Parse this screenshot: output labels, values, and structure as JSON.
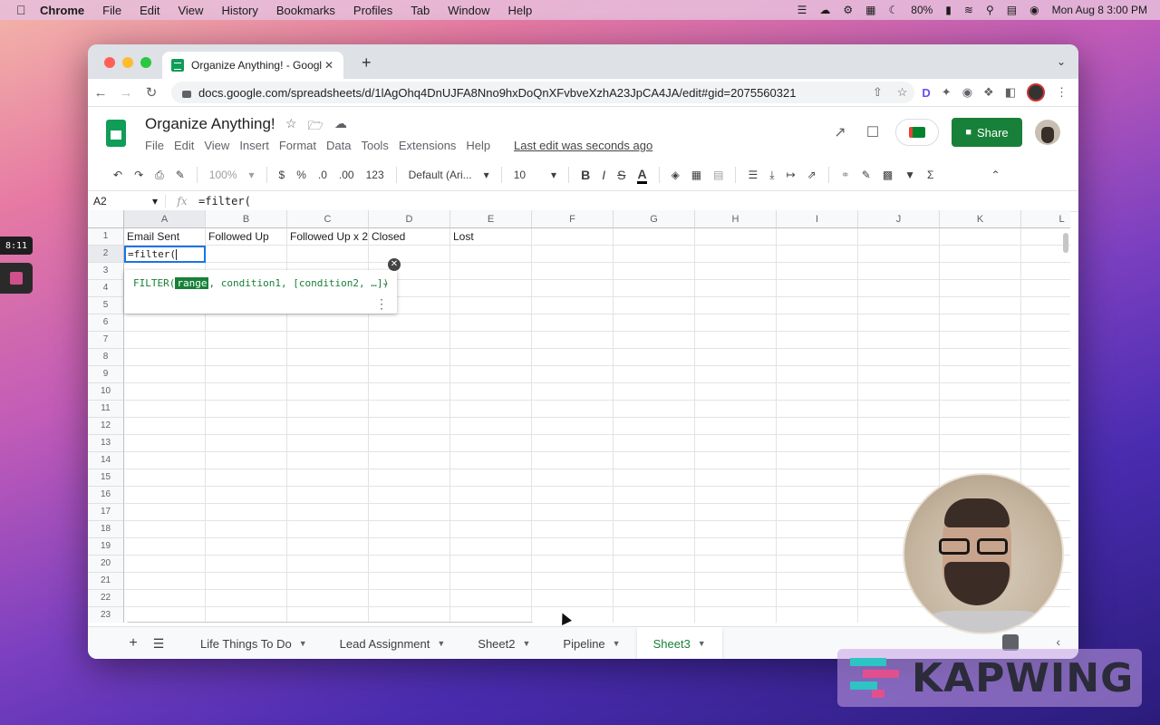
{
  "menubar": {
    "app": "Chrome",
    "items": [
      "File",
      "Edit",
      "View",
      "History",
      "Bookmarks",
      "Profiles",
      "Tab",
      "Window",
      "Help"
    ],
    "battery": "80%",
    "datetime": "Mon Aug 8  3:00 PM"
  },
  "recorder": {
    "time": "8:11"
  },
  "browser": {
    "tab_title": "Organize Anything! - Google S",
    "url": "docs.google.com/spreadsheets/d/1lAgOhq4DnUJFA8Nno9hxDoQnXFvbveXzhA23JpCA4JA/edit#gid=2075560321"
  },
  "doc": {
    "title": "Organize Anything!",
    "menus": [
      "File",
      "Edit",
      "View",
      "Insert",
      "Format",
      "Data",
      "Tools",
      "Extensions",
      "Help"
    ],
    "last_edit": "Last edit was seconds ago",
    "share_label": "Share"
  },
  "toolbar": {
    "zoom": "100%",
    "currency": "$",
    "percent": "%",
    "dec_less": ".0",
    "dec_more": ".00",
    "number_format": "123",
    "font": "Default (Ari...",
    "font_size": "10",
    "bold": "B",
    "italic": "I",
    "strike": "S",
    "text_color": "A",
    "sum": "Σ"
  },
  "formula_bar": {
    "name_box": "A2",
    "fx": "fx",
    "value": "=filter("
  },
  "grid": {
    "columns": [
      "A",
      "B",
      "C",
      "D",
      "E",
      "F",
      "G",
      "H",
      "I",
      "J",
      "K",
      "L"
    ],
    "rows": [
      "1",
      "2",
      "3",
      "4",
      "5",
      "6",
      "7",
      "8",
      "9",
      "10",
      "11",
      "12",
      "13",
      "14",
      "15",
      "16",
      "17",
      "18",
      "19",
      "20",
      "21",
      "22",
      "23"
    ],
    "row1": [
      "Email Sent",
      "Followed Up",
      "Followed Up x 2",
      "Closed",
      "Lost"
    ],
    "active_cell_text": "=filter(",
    "active_cell": "A2"
  },
  "formula_help": {
    "fn_open": "FILTER(",
    "arg_highlight": "range",
    "rest": ", condition1, [condition2, …])"
  },
  "sheets": {
    "tabs": [
      "Life Things To Do",
      "Lead Assignment",
      "Sheet2",
      "Pipeline",
      "Sheet3"
    ],
    "active": "Sheet3"
  },
  "watermark": {
    "text": "KAPWING"
  },
  "colors": {
    "sheets_green": "#188038",
    "selection_blue": "#1a73e8",
    "kapwing_teal": "#2ec4c4",
    "kapwing_pink": "#e0508f"
  }
}
